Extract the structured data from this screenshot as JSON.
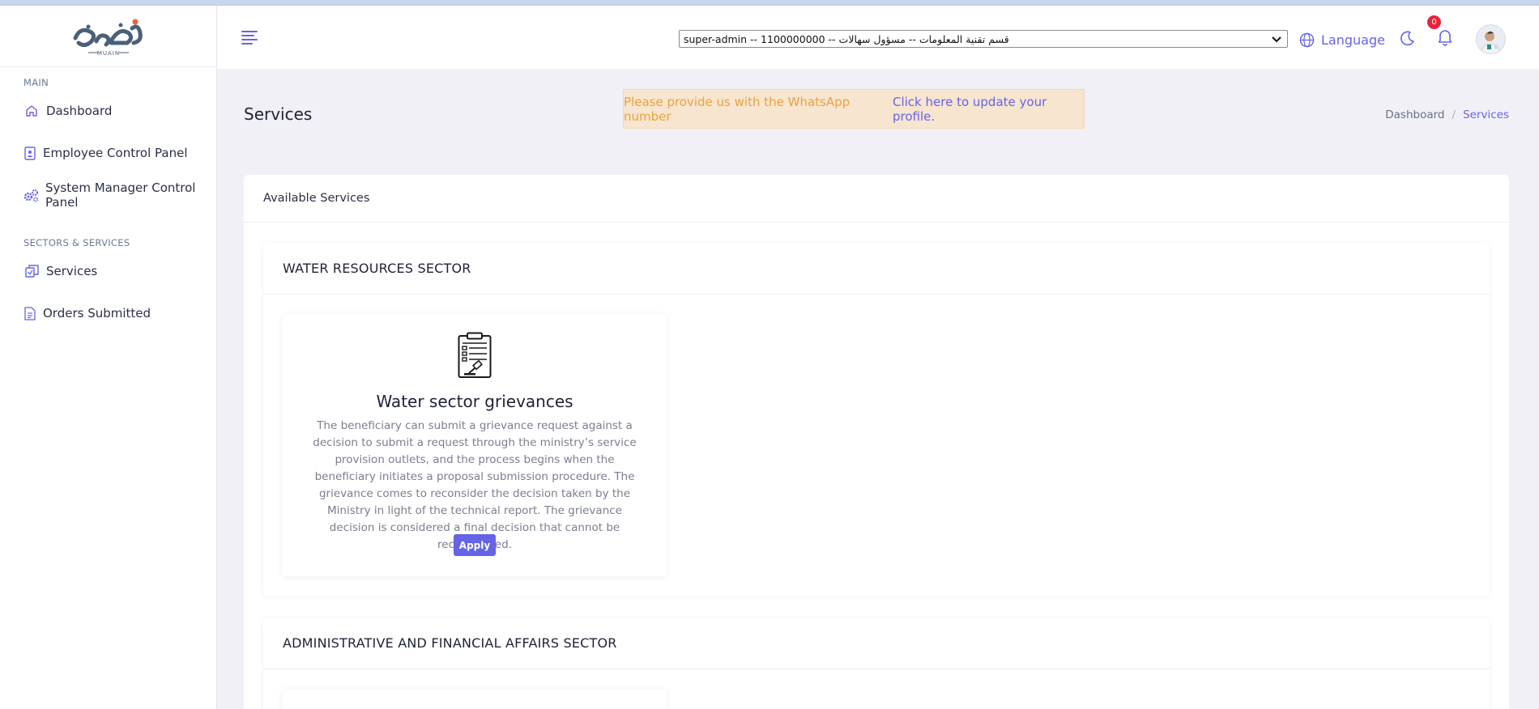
{
  "sidebar": {
    "logo_text": "معين",
    "logo_sub": "MUAIN",
    "sections": [
      {
        "title": "MAIN"
      },
      {
        "title": "SECTORS & SERVICES"
      }
    ],
    "items": [
      {
        "label": "Dashboard",
        "icon": "home-icon"
      },
      {
        "label": "Employee Control Panel",
        "icon": "badge-icon"
      },
      {
        "label": "System Manager Control Panel",
        "icon": "gears-icon"
      },
      {
        "label": "Services",
        "icon": "copy-icon"
      },
      {
        "label": "Orders Submitted",
        "icon": "document-icon"
      }
    ]
  },
  "header": {
    "role_select_value": "super-admin -- 1100000000 -- قسم تقنية المعلومات -- مسؤول سهالات",
    "language_label": "Language",
    "notification_count": "0"
  },
  "page": {
    "title": "Services",
    "alert": {
      "text": "Please provide us with the WhatsApp number",
      "link": "Click here to update your profile."
    },
    "breadcrumb": {
      "home": "Dashboard",
      "separator": "/",
      "current": "Services"
    }
  },
  "card": {
    "title": "Available Services",
    "sectors": [
      {
        "title": "WATER RESOURCES SECTOR",
        "services": [
          {
            "title": "Water sector grievances",
            "description": "The beneficiary can submit a grievance request against a decision to submit a request through the ministry’s service provision outlets, and the process begins when the beneficiary initiates a proposal submission procedure. The grievance comes to reconsider the decision taken by the Ministry in light of the technical report. The grievance decision is considered a final decision that cannot be reconsidered.",
            "button": "Apply"
          }
        ]
      },
      {
        "title": "ADMINISTRATIVE AND FINANCIAL AFFAIRS SECTOR",
        "services": []
      }
    ]
  },
  "colors": {
    "accent": "#6563e6",
    "alert_bg": "#f7e5cf",
    "alert_text": "#e8a43c",
    "badge": "#e8243d"
  }
}
